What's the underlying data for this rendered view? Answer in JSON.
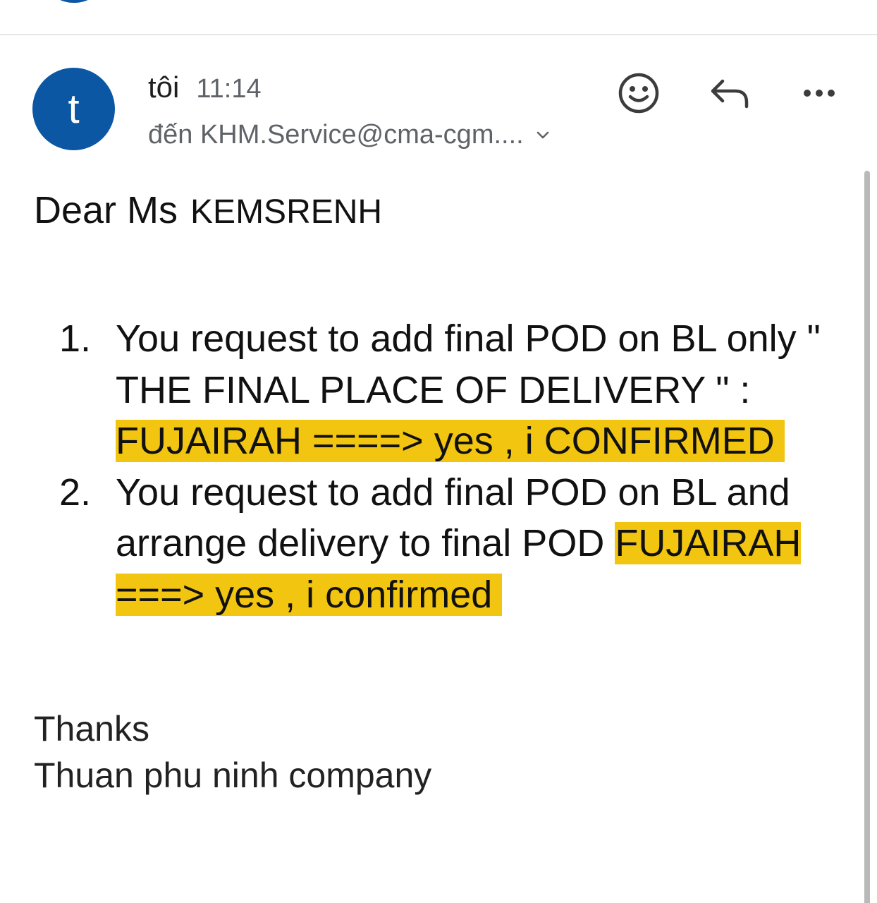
{
  "header": {
    "sender_avatar_letter": "t",
    "sender_name": "tôi",
    "time": "11:14",
    "recipient": "đến KHM.Service@cma-cgm....",
    "icons": [
      "smiley-icon",
      "reply-icon",
      "more-icon",
      "chevron-down-icon"
    ]
  },
  "body": {
    "greeting_prefix": "Dear Ms",
    "greeting_name": "KEMSRENH",
    "items": [
      {
        "number": "1.",
        "text": "You request to add final POD on BL only \" THE FINAL PLACE OF DELIVERY \" : ",
        "highlight": "FUJAIRAH  ====> yes , i CONFIRMED"
      },
      {
        "number": "2.",
        "text": "You request to add final POD on BL and arrange delivery to final POD ",
        "highlight": "FUJAIRAH ===> yes , i confirmed"
      }
    ],
    "closing_1": "Thanks",
    "closing_2": "Thuan phu ninh company"
  },
  "colors": {
    "avatar": "#0b57a4",
    "highlight": "#f2c511",
    "secondary_text": "#5f6368"
  }
}
